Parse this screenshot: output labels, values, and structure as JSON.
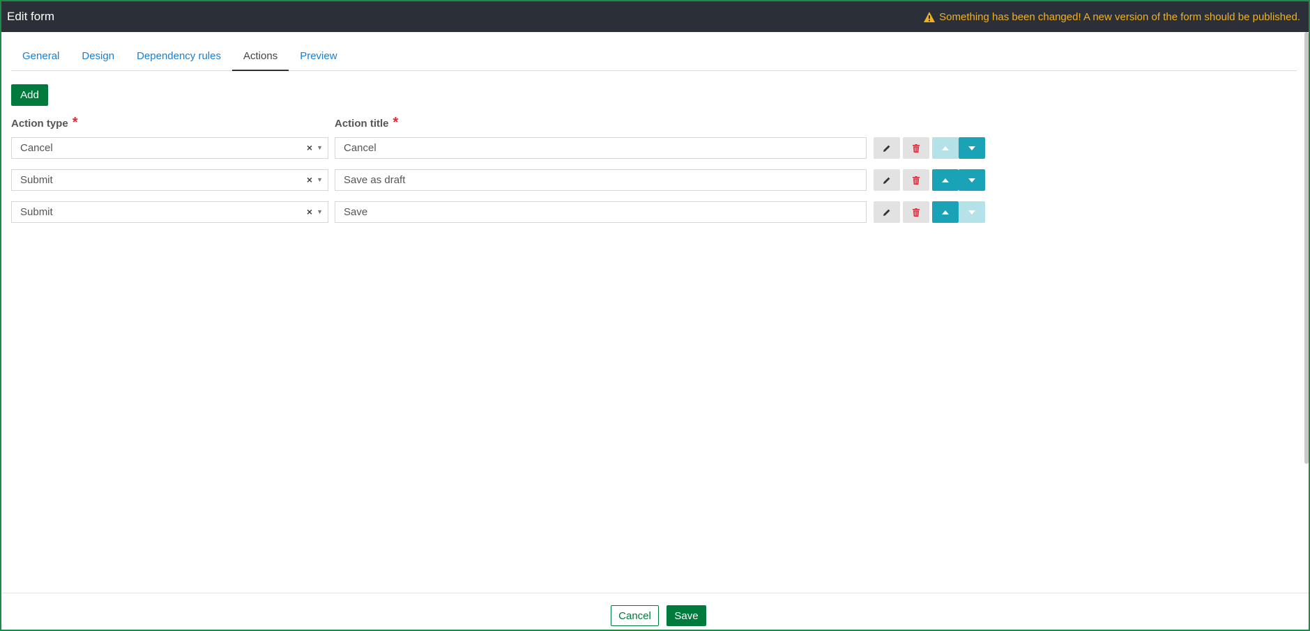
{
  "header": {
    "title": "Edit form",
    "warning": "Something has been changed! A new version of the form should be published."
  },
  "tabs": [
    {
      "label": "General"
    },
    {
      "label": "Design"
    },
    {
      "label": "Dependency rules"
    },
    {
      "label": "Actions",
      "active": true
    },
    {
      "label": "Preview"
    }
  ],
  "toolbar": {
    "add_label": "Add"
  },
  "columns": {
    "action_type": "Action type",
    "action_title": "Action title",
    "required_mark": "*"
  },
  "actions": [
    {
      "type": "Cancel",
      "title": "Cancel",
      "up_enabled": false,
      "down_enabled": true
    },
    {
      "type": "Submit",
      "title": "Save as draft",
      "up_enabled": true,
      "down_enabled": true
    },
    {
      "type": "Submit",
      "title": "Save",
      "up_enabled": true,
      "down_enabled": false
    }
  ],
  "select_clear_glyph": "×",
  "select_arrow_glyph": "▼",
  "footer": {
    "cancel_label": "Cancel",
    "save_label": "Save"
  },
  "colors": {
    "header_bg": "#2b2f38",
    "warning": "#f2b01e",
    "primary_green": "#007a3d",
    "teal": "#1aa3b7",
    "link_blue": "#1a7fd1",
    "required_red": "#e0293a"
  },
  "icons": {
    "warning": "warning-triangle-icon",
    "edit": "pencil-icon",
    "delete": "trash-icon",
    "up": "caret-up-icon",
    "down": "caret-down-icon"
  }
}
